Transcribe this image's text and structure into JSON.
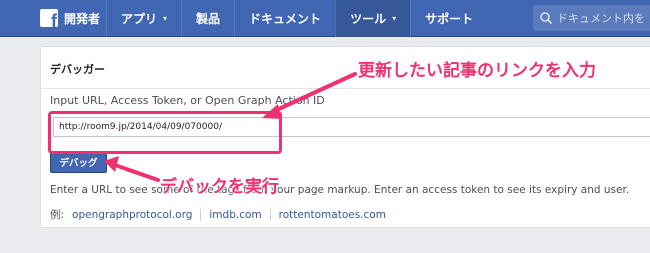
{
  "header": {
    "brand": "開発者",
    "nav": [
      {
        "label": "アプリ",
        "caret": "▾"
      },
      {
        "label": "製品"
      },
      {
        "label": "ドキュメント"
      },
      {
        "label": "ツール",
        "caret": "▾",
        "active": true
      },
      {
        "label": "サポート"
      }
    ],
    "search_placeholder": "ドキュメント内を"
  },
  "panel": {
    "title": "デバッガー",
    "instruction": "Input URL, Access Token, or Open Graph Action ID",
    "url_value": "http://room9.jp/2014/04/09/070000/",
    "debug_button": "デバッグ",
    "helper": "Enter a URL to see some of the tags from your page markup. Enter an access token to see its expiry and user.",
    "examples_prefix": "例:",
    "examples": [
      "opengraphprotocol.org",
      "imdb.com",
      "rottentomatoes.com"
    ]
  },
  "annotations": {
    "top_label": "更新したい記事のリンクを入力",
    "bottom_label": "デバックを実行",
    "color": "#f0316f"
  }
}
